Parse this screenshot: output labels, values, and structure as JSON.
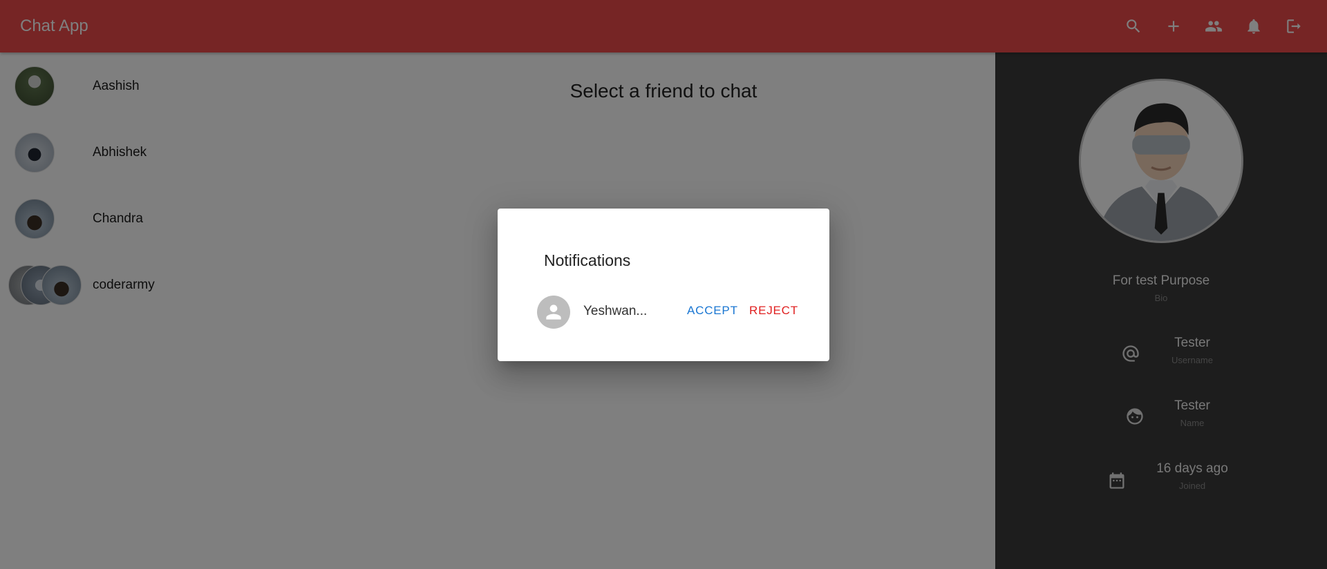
{
  "header": {
    "title": "Chat App",
    "background": "#ec4a4a",
    "actions": [
      {
        "name": "search-icon"
      },
      {
        "name": "add-icon"
      },
      {
        "name": "people-icon"
      },
      {
        "name": "bell-icon"
      },
      {
        "name": "logout-icon"
      }
    ]
  },
  "sidebar": {
    "friends": [
      {
        "name": "Aashish"
      },
      {
        "name": "Abhishek"
      },
      {
        "name": "Chandra"
      },
      {
        "name": "coderarmy"
      }
    ]
  },
  "main": {
    "placeholder": "Select a friend to chat"
  },
  "profile": {
    "bio": "For test Purpose",
    "bio_label": "Bio",
    "username": "Tester",
    "username_label": "Username",
    "name": "Tester",
    "name_label": "Name",
    "joined": "16 days ago",
    "joined_label": "Joined"
  },
  "dialog": {
    "title": "Notifications",
    "items": [
      {
        "name": "Yeshwan...",
        "accept_label": "ACCEPT",
        "reject_label": "REJECT"
      }
    ],
    "colors": {
      "accept": "#1976d2",
      "reject": "#e02020"
    }
  }
}
